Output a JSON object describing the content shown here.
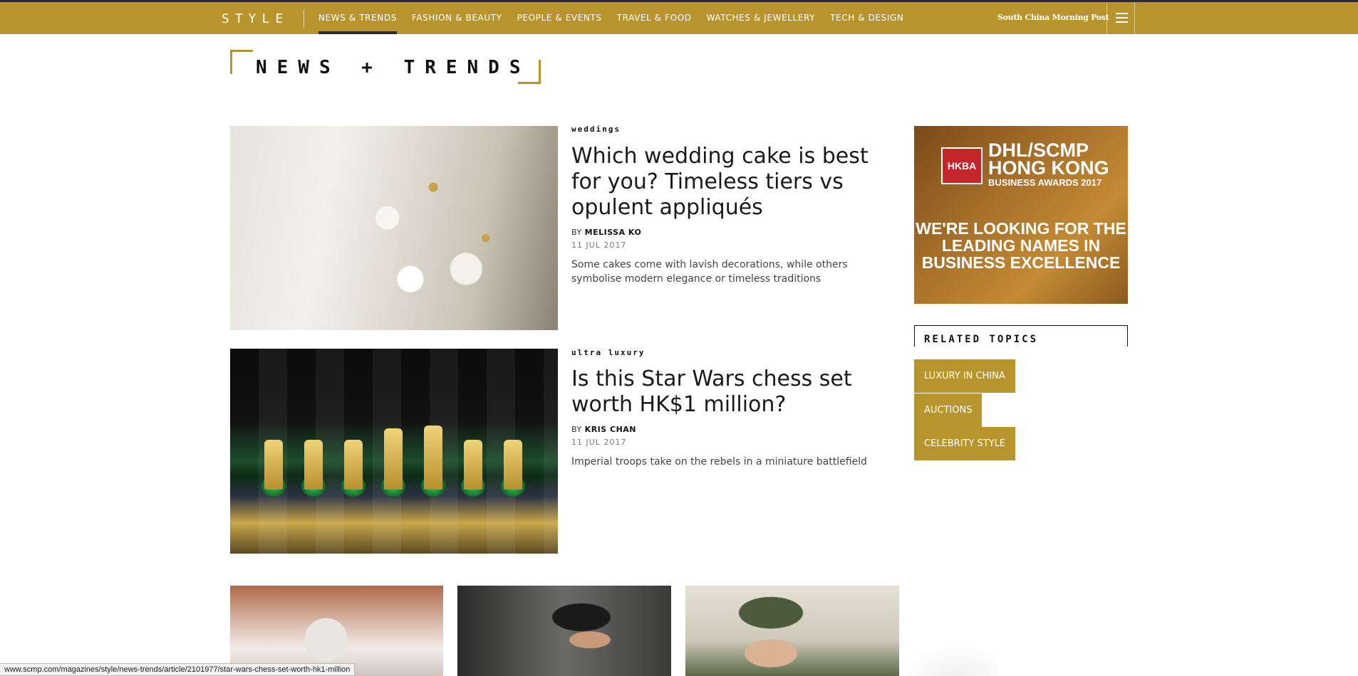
{
  "header": {
    "logo": "STYLE",
    "nav": [
      {
        "label": "NEWS & TRENDS",
        "active": true
      },
      {
        "label": "FASHION & BEAUTY",
        "active": false
      },
      {
        "label": "PEOPLE & EVENTS",
        "active": false
      },
      {
        "label": "TRAVEL & FOOD",
        "active": false
      },
      {
        "label": "WATCHES & JEWELLERY",
        "active": false
      },
      {
        "label": "TECH & DESIGN",
        "active": false
      }
    ],
    "brand": "South China Morning Post",
    "menu_icon": "hamburger-icon"
  },
  "section": {
    "title": "NEWS + TRENDS"
  },
  "articles": [
    {
      "tag": "WEDDINGS",
      "headline": "Which wedding cake is best for you? Timeless tiers vs opulent appliqués",
      "by": "BY",
      "author": "MELISSA KO",
      "date": "11 JUL 2017",
      "summary": "Some cakes come with lavish decorations, while others symbolise modern elegance or timeless traditions"
    },
    {
      "tag": "ULTRA LUXURY",
      "headline": "Is this Star Wars chess set worth HK$1 million?",
      "by": "BY",
      "author": "KRIS CHAN",
      "date": "11 JUL 2017",
      "summary": "Imperial troops take on the rebels in a miniature battlefield"
    }
  ],
  "ad": {
    "logo_text": "HKBA",
    "logo_year": "2017",
    "title_line1": "DHL/SCMP",
    "title_line2": "HONG KONG",
    "title_line3": "BUSINESS AWARDS 2017",
    "cta": "WE'RE LOOKING FOR THE LEADING NAMES IN BUSINESS EXCELLENCE"
  },
  "related": {
    "title": "RELATED TOPICS",
    "topics": [
      "LUXURY IN CHINA",
      "AUCTIONS",
      "CELEBRITY STYLE"
    ]
  },
  "statusbar": {
    "url": "www.scmp.com/magazines/style/news-trends/article/2101977/star-wars-chess-set-worth-hk1-million"
  },
  "colors": {
    "accent": "#b8952c",
    "dark": "#2b2b2b"
  }
}
